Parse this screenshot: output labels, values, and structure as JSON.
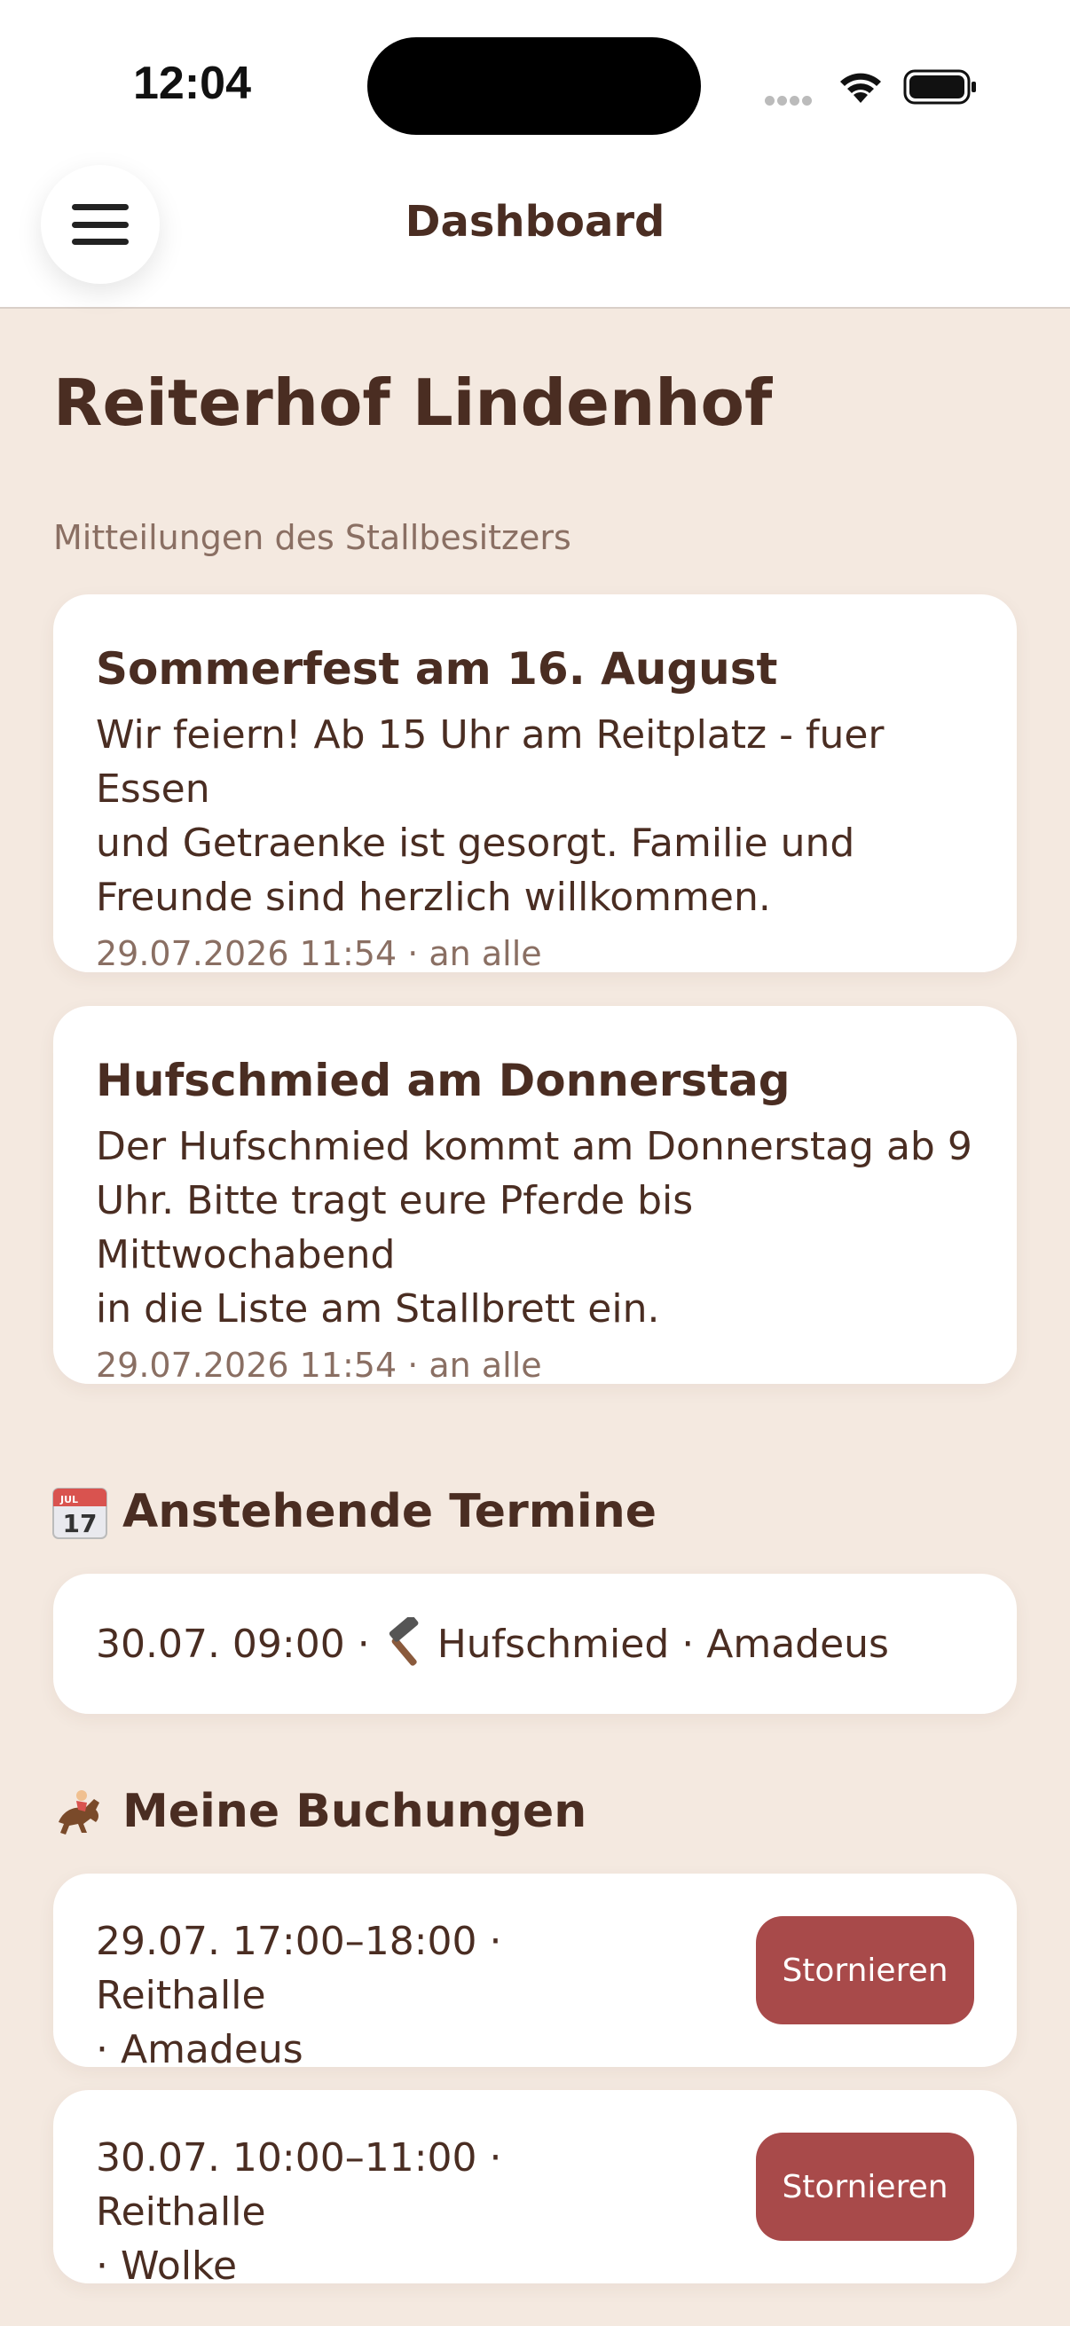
{
  "status_bar": {
    "time": "12:04"
  },
  "header": {
    "title": "Dashboard",
    "menu_icon": "hamburger-menu-icon"
  },
  "farm": {
    "name": "Reiterhof Lindenhof"
  },
  "announcements": {
    "label": "Mitteilungen des Stallbesitzers",
    "items": [
      {
        "title": "Sommerfest am 16. August",
        "body_lines": [
          "Wir feiern! Ab 15 Uhr am Reitplatz - fuer Essen",
          "und Getraenke ist gesorgt. Familie und",
          "Freunde sind herzlich willkommen."
        ],
        "meta": "29.07.2026 11:54 · an alle"
      },
      {
        "title": "Hufschmied am Donnerstag",
        "body_lines": [
          "Der Hufschmied kommt am Donnerstag ab 9",
          "Uhr. Bitte tragt eure Pferde bis Mittwochabend",
          "in die Liste am Stallbrett ein."
        ],
        "meta": "29.07.2026 11:54 · an alle"
      }
    ]
  },
  "appointments": {
    "heading": "Anstehende Termine",
    "icon": "calendar-icon",
    "items": [
      {
        "prefix": "30.07. 09:00 ·",
        "icon": "hammer-icon",
        "suffix": "Hufschmied · Amadeus"
      }
    ]
  },
  "bookings": {
    "heading": "Meine Buchungen",
    "icon": "horse-racing-icon",
    "cancel_label": "Stornieren",
    "items": [
      {
        "lines": [
          "29.07. 17:00–18:00 · Reithalle",
          "· Amadeus"
        ]
      },
      {
        "lines": [
          "30.07. 10:00–11:00 · Reithalle",
          "· Wolke"
        ]
      }
    ]
  },
  "colors": {
    "background": "#f4e9e0",
    "text": "#4a2d22",
    "muted": "#8a6f63",
    "cancel": "#a84a4a"
  }
}
